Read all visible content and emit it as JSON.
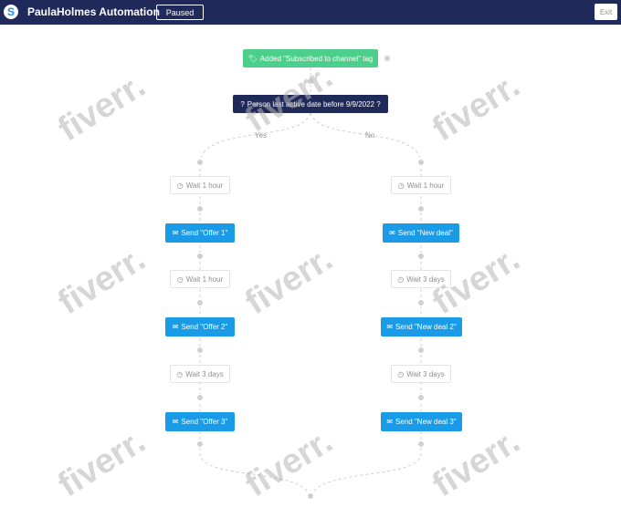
{
  "app": {
    "logo_letter": "S",
    "title": "PaulaHolmes Automation",
    "status": "Paused",
    "exit_label": "Exit"
  },
  "flow": {
    "trigger": "Added \"Subscribed to channel\" tag",
    "condition": "Person last active date before 9/9/2022 ?",
    "yes_label": "Yes",
    "no_label": "No",
    "left": {
      "wait1": "Wait 1 hour",
      "send1": "Send \"Offer 1\"",
      "wait2": "Wait 1 hour",
      "send2": "Send \"Offer 2\"",
      "wait3": "Wait 3 days",
      "send3": "Send \"Offer 3\""
    },
    "right": {
      "wait1": "Wait 1 hour",
      "send1": "Send \"New deal\"",
      "wait2": "Wait 3 days",
      "send2": "Send \"New deal 2\"",
      "wait3": "Wait 3 days",
      "send3": "Send \"New deal 3\""
    }
  },
  "watermark": "fiverr.",
  "colors": {
    "header": "#1f2a5b",
    "trigger": "#4ccf8a",
    "send": "#1a9be8",
    "condition": "#1f2a5b"
  }
}
